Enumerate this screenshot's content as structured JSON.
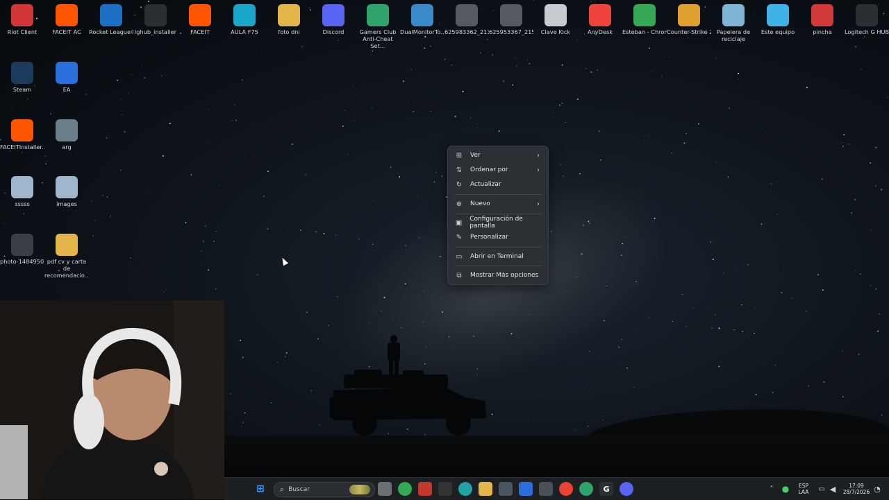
{
  "desktop": {
    "icons": [
      {
        "label": "Riot Client",
        "icon": "riot-icon",
        "color": "#d13639"
      },
      {
        "label": "FACEIT AC",
        "icon": "faceit-ac-icon",
        "color": "#ff5500"
      },
      {
        "label": "Rocket League®",
        "icon": "rocket-league-icon",
        "color": "#1d6fc4"
      },
      {
        "label": "lghub_installer",
        "icon": "logitech-icon",
        "color": "#2b2f34"
      },
      {
        "label": "FACEIT",
        "icon": "faceit-icon",
        "color": "#ff5500"
      },
      {
        "label": "AULA F75",
        "icon": "aula-icon",
        "color": "#1aa5c9"
      },
      {
        "label": "foto dni",
        "icon": "folder-icon",
        "color": "#e2b64a"
      },
      {
        "label": "Discord",
        "icon": "discord-icon",
        "color": "#5865f2"
      },
      {
        "label": "Gamers Club Anti-Cheat Set...",
        "icon": "gamers-club-icon",
        "color": "#2fa36b"
      },
      {
        "label": "DualMonitorTo...",
        "icon": "monitor-icon",
        "color": "#3a8ac9"
      },
      {
        "label": "625983362_213...",
        "icon": "image-file-icon",
        "color": "#555a60"
      },
      {
        "label": "625953367_215...",
        "icon": "image-file-icon",
        "color": "#555a60"
      },
      {
        "label": "Clave Kick",
        "icon": "text-file-icon",
        "color": "#c8ccd0"
      },
      {
        "label": "AnyDesk",
        "icon": "anydesk-icon",
        "color": "#ef443b"
      },
      {
        "label": "Esteban - Chrome",
        "icon": "chrome-icon",
        "color": "#34a853"
      },
      {
        "label": "Counter-Strike 2",
        "icon": "cs2-icon",
        "color": "#e0a030"
      },
      {
        "label": "Papelera de reciclaje",
        "icon": "recycle-bin-icon",
        "color": "#7fb6d8"
      },
      {
        "label": "Este equipo",
        "icon": "computer-icon",
        "color": "#3fb3e6"
      },
      {
        "label": "pincha",
        "icon": "pincha-icon",
        "color": "#d23a3a"
      },
      {
        "label": "Logitech G HUB",
        "icon": "logitech-ghub-icon",
        "color": "#2b2f34"
      },
      {
        "label": "Steam",
        "icon": "steam-icon",
        "color": "#1b3a5c"
      },
      {
        "label": "EA",
        "icon": "ea-icon",
        "color": "#2a6fdc"
      },
      {
        "label": "FACEITInstaller...",
        "icon": "faceit-installer-icon",
        "color": "#ff5500"
      },
      {
        "label": "arg",
        "icon": "image-file-icon",
        "color": "#6b7f8a"
      },
      {
        "label": "sssss",
        "icon": "document-icon",
        "color": "#9fb6cc"
      },
      {
        "label": "images",
        "icon": "document-icon",
        "color": "#9fb6cc"
      },
      {
        "label": "photo-1484950...",
        "icon": "photo-icon",
        "color": "#3a3f45"
      },
      {
        "label": "pdf cv y carta de recomendacio...",
        "icon": "folder-icon",
        "color": "#e2b64a"
      }
    ]
  },
  "context_menu": {
    "items": [
      {
        "label": "Ver",
        "icon": "grid-icon",
        "submenu": true
      },
      {
        "label": "Ordenar por",
        "icon": "sort-icon",
        "submenu": true
      },
      {
        "label": "Actualizar",
        "icon": "refresh-icon",
        "submenu": false
      },
      {
        "label": "Nuevo",
        "icon": "plus-circle-icon",
        "submenu": true
      },
      {
        "label": "Configuración de pantalla",
        "icon": "display-icon",
        "submenu": false
      },
      {
        "label": "Personalizar",
        "icon": "pencil-icon",
        "submenu": false
      },
      {
        "label": "Abrir en Terminal",
        "icon": "terminal-icon",
        "submenu": false
      },
      {
        "label": "Mostrar Más opciones",
        "icon": "more-options-icon",
        "submenu": false
      }
    ]
  },
  "taskbar": {
    "search_placeholder": "Buscar",
    "apps": [
      "start-icon",
      "task-view-icon",
      "chrome-icon",
      "shield-icon",
      "epic-games-icon",
      "edge-icon",
      "file-explorer-icon",
      "store-icon",
      "mail-icon",
      "calculator-icon",
      "chrome-icon",
      "gamers-club-icon",
      "logitech-ghub-icon",
      "discord-icon"
    ],
    "tray": {
      "language": "ESP",
      "layout": "LAA",
      "time": "17:09",
      "date": "28/7/2026"
    }
  },
  "colors": {
    "taskbar_bg": "#1d2023",
    "menu_bg": "#2c2f33",
    "accent": "#3a8ee6"
  }
}
